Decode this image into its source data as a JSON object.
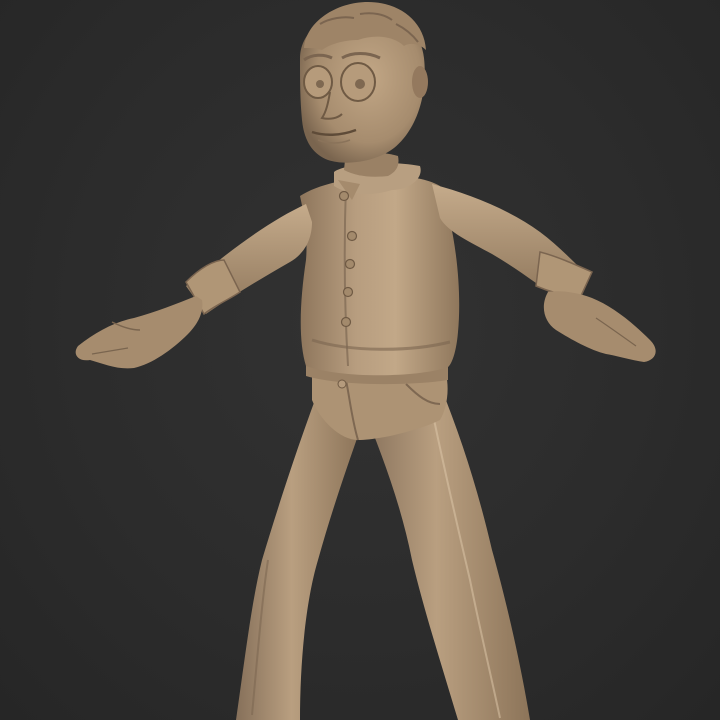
{
  "scene": {
    "background_color": "#2b2b2b",
    "clay_base_color": "#b49a7c",
    "clay_shadow_color": "#6f5a44",
    "clay_highlight_color": "#cdb497"
  },
  "model": {
    "subject": "sculpted-clay-character",
    "pose": "a-pose",
    "parts": [
      "head",
      "hair",
      "shirt",
      "collar",
      "buttons",
      "cuffs",
      "hands",
      "belt",
      "trousers"
    ]
  }
}
